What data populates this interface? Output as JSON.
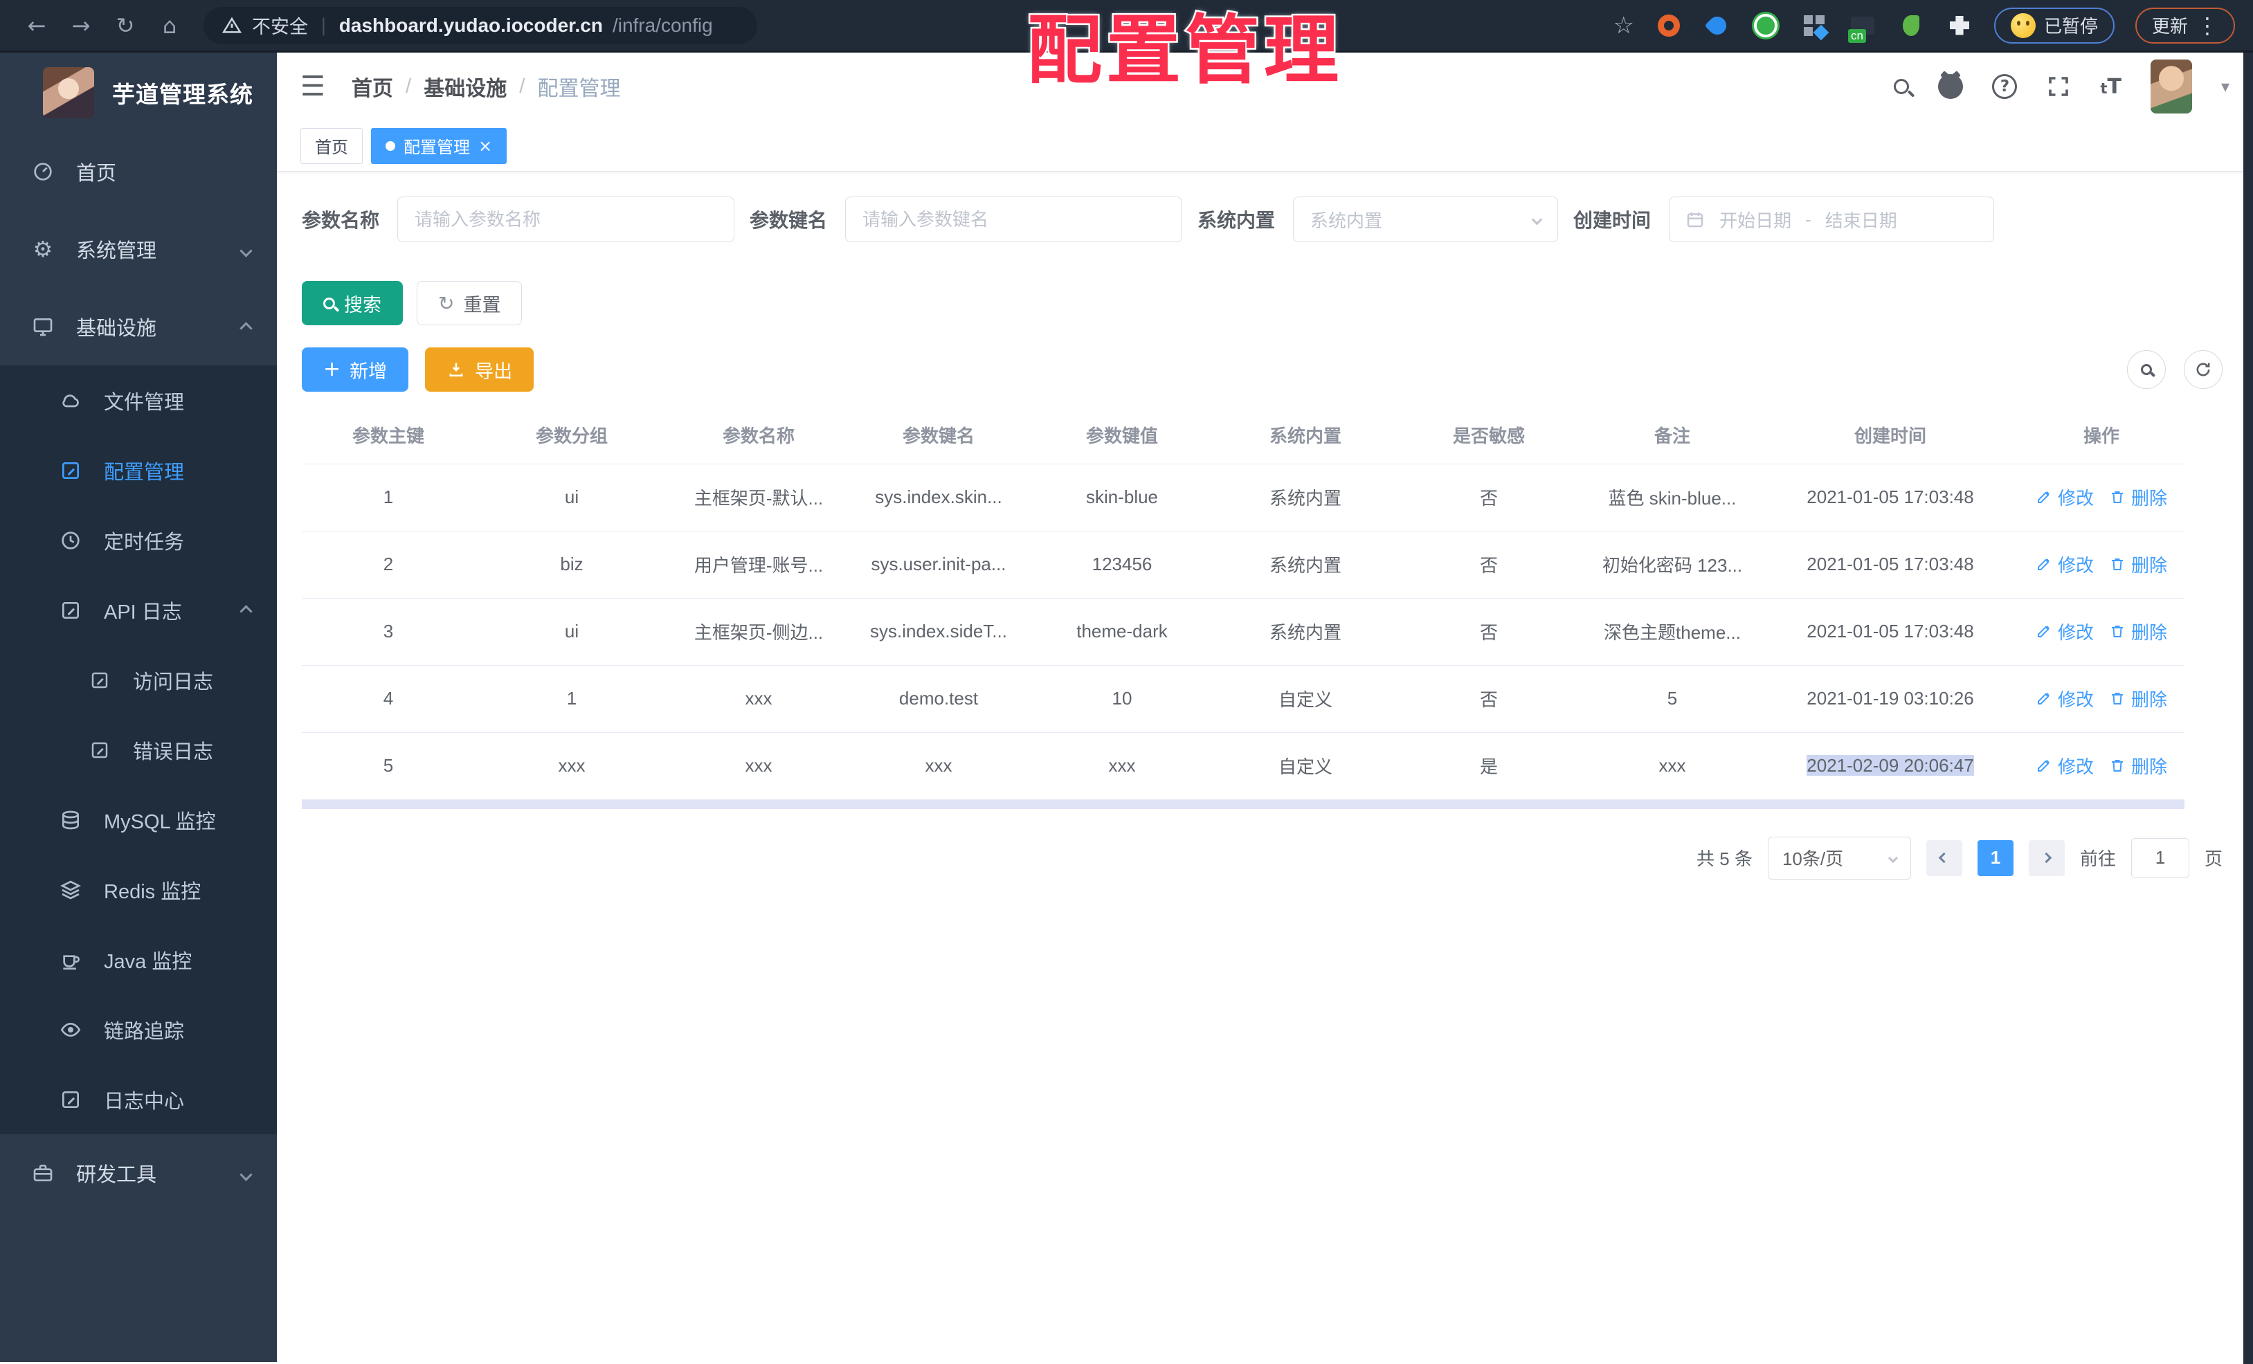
{
  "overlay_title": "配置管理",
  "browser": {
    "security": "不安全",
    "host": "dashboard.yudao.iocoder.cn",
    "path": "/infra/config",
    "cn_badge": "cn",
    "paused": "已暂停",
    "update": "更新"
  },
  "icons": {
    "back": "←",
    "forward": "→",
    "reload": "↻",
    "home": "⌂",
    "divider": "|",
    "star": "☆",
    "kebab": "⋮",
    "hamburger": "☰",
    "gear": "⚙",
    "question": "?",
    "tt_small": "t",
    "tt_big": "T",
    "caret": "▾",
    "close": "×",
    "plus": "+",
    "reset_arrow": "↻"
  },
  "sidebar": {
    "title": "芋道管理系统",
    "items": [
      {
        "label": "首页"
      },
      {
        "label": "系统管理"
      },
      {
        "label": "基础设施"
      },
      {
        "label": "文件管理"
      },
      {
        "label": "配置管理"
      },
      {
        "label": "定时任务"
      },
      {
        "label": "API 日志"
      },
      {
        "label": "访问日志"
      },
      {
        "label": "错误日志"
      },
      {
        "label": "MySQL 监控"
      },
      {
        "label": "Redis 监控"
      },
      {
        "label": "Java 监控"
      },
      {
        "label": "链路追踪"
      },
      {
        "label": "日志中心"
      },
      {
        "label": "研发工具"
      }
    ]
  },
  "breadcrumb": {
    "items": [
      "首页",
      "基础设施",
      "配置管理"
    ],
    "sep": "/"
  },
  "tabs": [
    {
      "label": "首页"
    },
    {
      "label": "配置管理"
    }
  ],
  "filters": {
    "name_label": "参数名称",
    "name_placeholder": "请输入参数名称",
    "key_label": "参数键名",
    "key_placeholder": "请输入参数键名",
    "builtin_label": "系统内置",
    "builtin_placeholder": "系统内置",
    "time_label": "创建时间",
    "time_start": "开始日期",
    "time_sep": "-",
    "time_end": "结束日期",
    "search": "搜索",
    "reset": "重置"
  },
  "toolbar": {
    "add": "新增",
    "export": "导出"
  },
  "table": {
    "columns": [
      "参数主键",
      "参数分组",
      "参数名称",
      "参数键名",
      "参数键值",
      "系统内置",
      "是否敏感",
      "备注",
      "创建时间",
      "操作"
    ],
    "op_edit": "修改",
    "op_delete": "删除",
    "rows": [
      [
        "1",
        "ui",
        "主框架页-默认...",
        "sys.index.skin...",
        "skin-blue",
        "系统内置",
        "否",
        "蓝色 skin-blue...",
        "2021-01-05 17:03:48"
      ],
      [
        "2",
        "biz",
        "用户管理-账号...",
        "sys.user.init-pa...",
        "123456",
        "系统内置",
        "否",
        "初始化密码 123...",
        "2021-01-05 17:03:48"
      ],
      [
        "3",
        "ui",
        "主框架页-侧边...",
        "sys.index.sideT...",
        "theme-dark",
        "系统内置",
        "否",
        "深色主题theme...",
        "2021-01-05 17:03:48"
      ],
      [
        "4",
        "1",
        "xxx",
        "demo.test",
        "10",
        "自定义",
        "否",
        "5",
        "2021-01-19 03:10:26"
      ],
      [
        "5",
        "xxx",
        "xxx",
        "xxx",
        "xxx",
        "自定义",
        "是",
        "xxx",
        "2021-02-09 20:06:47"
      ]
    ]
  },
  "pagination": {
    "total": "共 5 条",
    "size": "10条/页",
    "page": "1",
    "goto": "前往",
    "goto_value": "1",
    "unit": "页"
  },
  "colors": {
    "primary": "#409eff",
    "success": "#14a385",
    "warning": "#f1a41f",
    "overlay_red": "#fb2e4d",
    "sidebar_bg": "#2d3a4b",
    "submenu_bg": "#1f2d3d"
  }
}
